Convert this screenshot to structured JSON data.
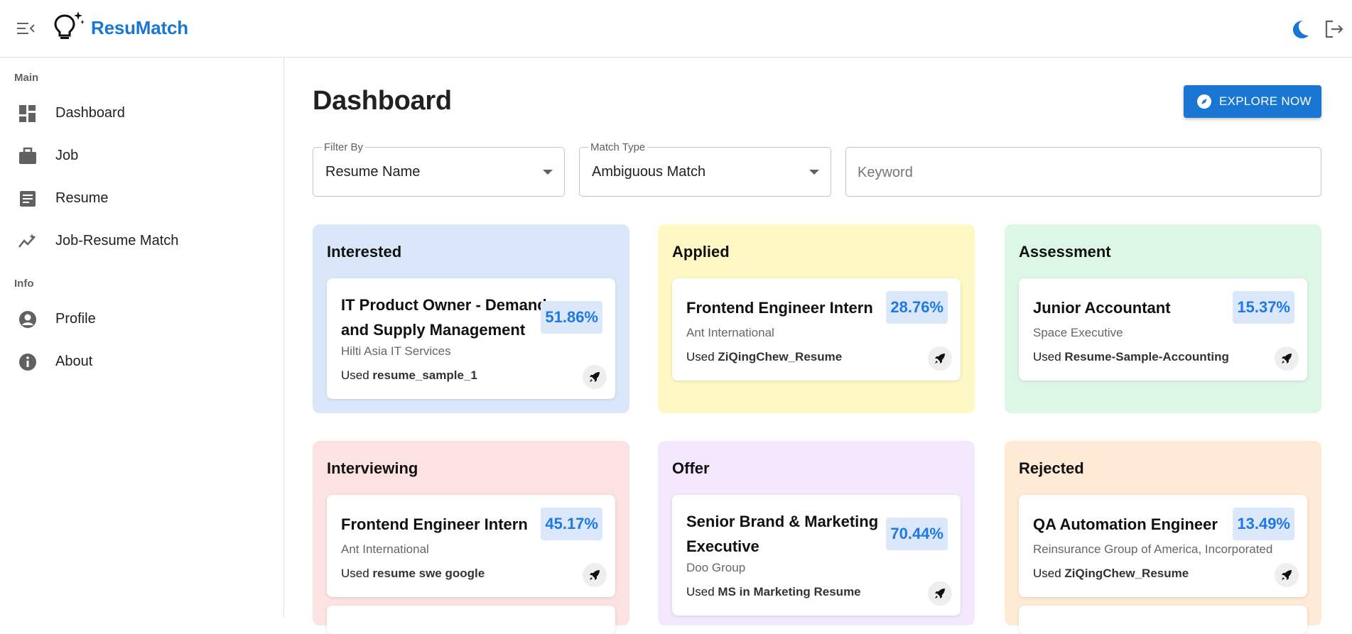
{
  "app": {
    "brand": "ResuMatch"
  },
  "sidebar": {
    "sections": [
      {
        "label": "Main"
      },
      {
        "label": "Info"
      }
    ],
    "items": [
      {
        "label": "Dashboard",
        "icon": "dashboard-icon"
      },
      {
        "label": "Job",
        "icon": "briefcase-icon"
      },
      {
        "label": "Resume",
        "icon": "document-icon"
      },
      {
        "label": "Job-Resume Match",
        "icon": "trend-icon"
      },
      {
        "label": "Profile",
        "icon": "account-circle-icon"
      },
      {
        "label": "About",
        "icon": "info-icon"
      }
    ]
  },
  "page": {
    "title": "Dashboard",
    "explore_label": "EXPLORE NOW"
  },
  "filters": {
    "filter_by": {
      "label": "Filter By",
      "value": "Resume Name"
    },
    "match_type": {
      "label": "Match Type",
      "value": "Ambiguous Match"
    },
    "keyword": {
      "placeholder": "Keyword",
      "value": ""
    }
  },
  "colors": {
    "accent": "#1976d2",
    "interested": "#dae7fb",
    "applied": "#fef8c4",
    "assessment": "#dcf7e6",
    "interviewing": "#fde2e2",
    "offer": "#f3e8fd",
    "rejected": "#feead5",
    "score_bg": "#dbe8fb",
    "score_text": "#1e78e8"
  },
  "columns": [
    {
      "title": "Interested",
      "card": {
        "job_title": "IT Product Owner - Demand and Supply Management",
        "company": "Hilti Asia IT Services",
        "used_prefix": "Used",
        "resume": "resume_sample_1",
        "score": "51.86%"
      }
    },
    {
      "title": "Applied",
      "card": {
        "job_title": "Frontend Engineer Intern",
        "company": "Ant International",
        "used_prefix": "Used",
        "resume": "ZiQingChew_Resume",
        "score": "28.76%"
      }
    },
    {
      "title": "Assessment",
      "card": {
        "job_title": "Junior Accountant",
        "company": "Space Executive",
        "used_prefix": "Used",
        "resume": "Resume-Sample-Accounting",
        "score": "15.37%"
      }
    },
    {
      "title": "Interviewing",
      "card": {
        "job_title": "Frontend Engineer Intern",
        "company": "Ant International",
        "used_prefix": "Used",
        "resume": "resume swe google",
        "score": "45.17%"
      }
    },
    {
      "title": "Offer",
      "card": {
        "job_title": "Senior Brand & Marketing Executive",
        "company": "Doo Group",
        "used_prefix": "Used",
        "resume": "MS in Marketing Resume",
        "score": "70.44%"
      }
    },
    {
      "title": "Rejected",
      "card": {
        "job_title": "QA Automation Engineer",
        "company": "Reinsurance Group of America, Incorporated",
        "used_prefix": "Used",
        "resume": "ZiQingChew_Resume",
        "score": "13.49%"
      }
    }
  ]
}
